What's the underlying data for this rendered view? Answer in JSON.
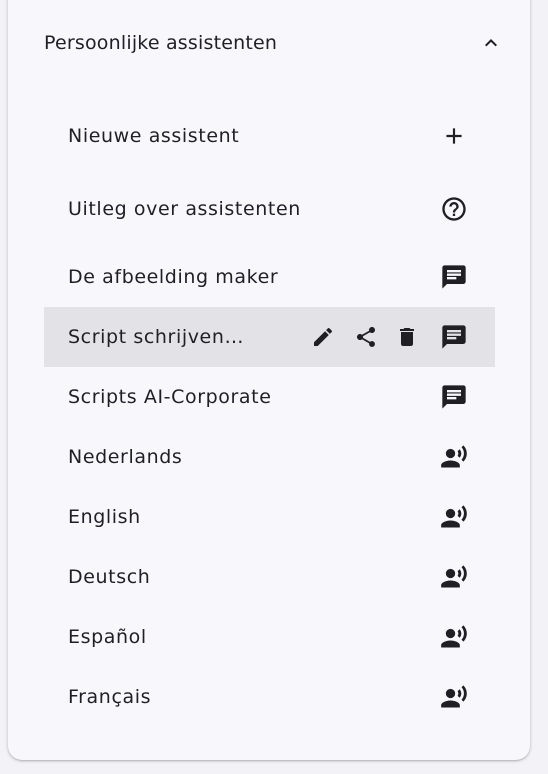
{
  "section": {
    "title": "Persoonlijke assistenten",
    "toggle_icon": "chevron-up-icon"
  },
  "items": [
    {
      "label": "Nieuwe assistent",
      "icon": "plus-icon"
    },
    {
      "label": "Uitleg over assistenten",
      "icon": "help-circle-icon"
    },
    {
      "label": "De afbeelding maker",
      "icon": "chat-icon"
    },
    {
      "label": "Script schrijven…",
      "icon": "chat-icon",
      "selected": true,
      "actions": [
        "edit-icon",
        "share-icon",
        "delete-icon"
      ]
    },
    {
      "label": "Scripts AI-Corporate",
      "icon": "chat-icon"
    },
    {
      "label": "Nederlands",
      "icon": "voice-icon"
    },
    {
      "label": "English",
      "icon": "voice-icon"
    },
    {
      "label": "Deutsch",
      "icon": "voice-icon"
    },
    {
      "label": "Español",
      "icon": "voice-icon"
    },
    {
      "label": "Français",
      "icon": "voice-icon"
    }
  ],
  "colors": {
    "background": "#f3f2f7",
    "panel": "#f8f7fc",
    "selected_row": "#e2e2e7",
    "text": "#1f1f24"
  }
}
